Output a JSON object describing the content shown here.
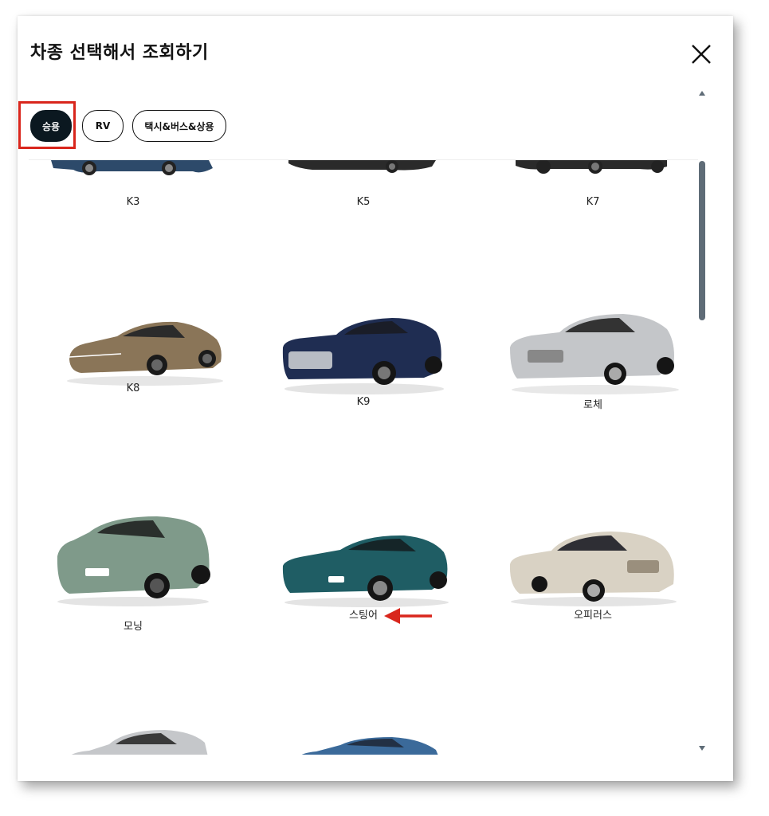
{
  "modal": {
    "title": "차종 선택해서 조회하기"
  },
  "tabs": [
    {
      "label": "승용",
      "active": true
    },
    {
      "label": "RV",
      "active": false
    },
    {
      "label": "택시&버스&상용",
      "active": false
    }
  ],
  "cars": [
    {
      "name": "K3",
      "color": "#2d4a6a"
    },
    {
      "name": "K5",
      "color": "#2a2a2a"
    },
    {
      "name": "K7",
      "color": "#2a2a2a"
    },
    {
      "name": "K8",
      "color": "#8a7558"
    },
    {
      "name": "K9",
      "color": "#1f2d52"
    },
    {
      "name": "로체",
      "color": "#c4c6c9"
    },
    {
      "name": "모닝",
      "color": "#7f9a8a"
    },
    {
      "name": "스팅어",
      "color": "#1f5d64"
    },
    {
      "name": "오피러스",
      "color": "#d9d2c4"
    },
    {
      "name": "",
      "color": "#c5c7ca"
    },
    {
      "name": "",
      "color": "#3b6a9a"
    }
  ],
  "icons": {
    "close": "close-icon",
    "scroll_up": "triangle-up-icon",
    "scroll_down": "triangle-down-icon",
    "annotation_arrow": "red-arrow-icon"
  },
  "colors": {
    "active_tab": "#0b1820",
    "highlight": "#d9261c",
    "scrollbar": "#5f6c77"
  }
}
